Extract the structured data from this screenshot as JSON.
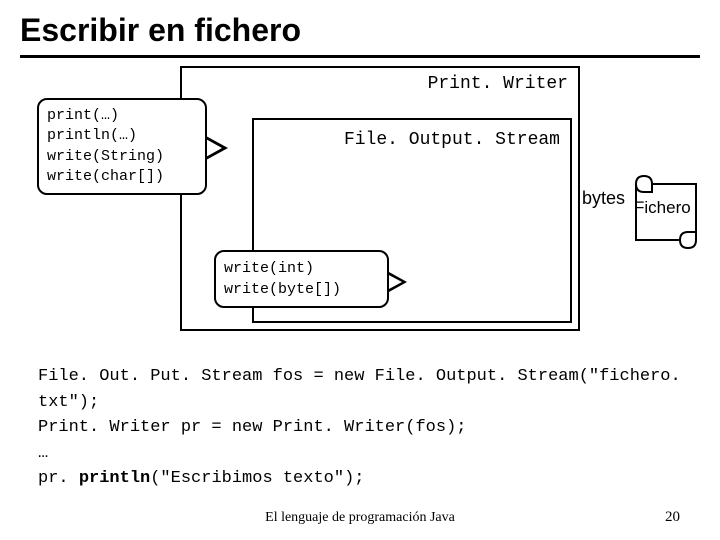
{
  "title": "Escribir en fichero",
  "outer_class": "Print. Writer",
  "inner_class": "File. Output. Stream",
  "methods_outer": {
    "l1": "print(…)",
    "l2": "println(…)",
    "l3": "write(String)",
    "l4": "write(char[])"
  },
  "methods_inner": {
    "l1": "write(int)",
    "l2": "write(byte[])"
  },
  "arrow_label": "bytes",
  "file_label": "Fichero",
  "code": {
    "l1": "File. Out. Put. Stream fos = new File. Output. Stream(\"fichero. txt\");",
    "l2": "Print. Writer pr = new Print. Writer(fos);",
    "l3": "…",
    "l4a": "pr. ",
    "l4b": "println",
    "l4c": "(\"Escribimos texto\");"
  },
  "footer": "El lenguaje de programación Java",
  "page": "20"
}
